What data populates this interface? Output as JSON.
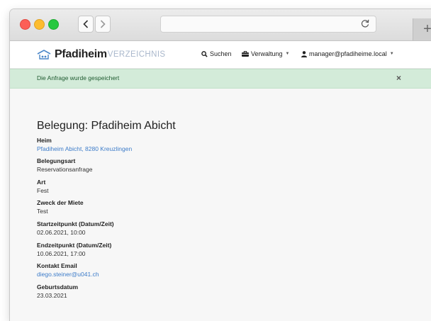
{
  "brand": {
    "main": "Pfadiheim",
    "sub": "VERZEICHNIS"
  },
  "nav": {
    "search": "Suchen",
    "admin": "Verwaltung",
    "user": "manager@pfadiheime.local"
  },
  "alert": {
    "message": "Die Anfrage wurde gespeichert",
    "close": "×"
  },
  "newtab": "+",
  "title": "Belegung: Pfadiheim Abicht",
  "fields": [
    {
      "label": "Heim",
      "value": "Pfadiheim Abicht, 8280 Kreuzlingen"
    },
    {
      "label": "Belegungsart",
      "value": "Reservationsanfrage"
    },
    {
      "label": "Art",
      "value": "Fest"
    },
    {
      "label": "Zweck der Miete",
      "value": "Test"
    },
    {
      "label": "Startzeitpunkt (Datum/Zeit)",
      "value": "02.06.2021, 10:00"
    },
    {
      "label": "Endzeitpunkt (Datum/Zeit)",
      "value": "10.06.2021, 17:00"
    },
    {
      "label": "Kontakt Email",
      "value": "diego.steiner@u041.ch"
    },
    {
      "label": "Geburtsdatum",
      "value": "23.03.2021"
    }
  ],
  "colors": {
    "link": "#3d7cc9",
    "alert_bg": "#d3ebd9",
    "alert_text": "#1e5a2f"
  }
}
